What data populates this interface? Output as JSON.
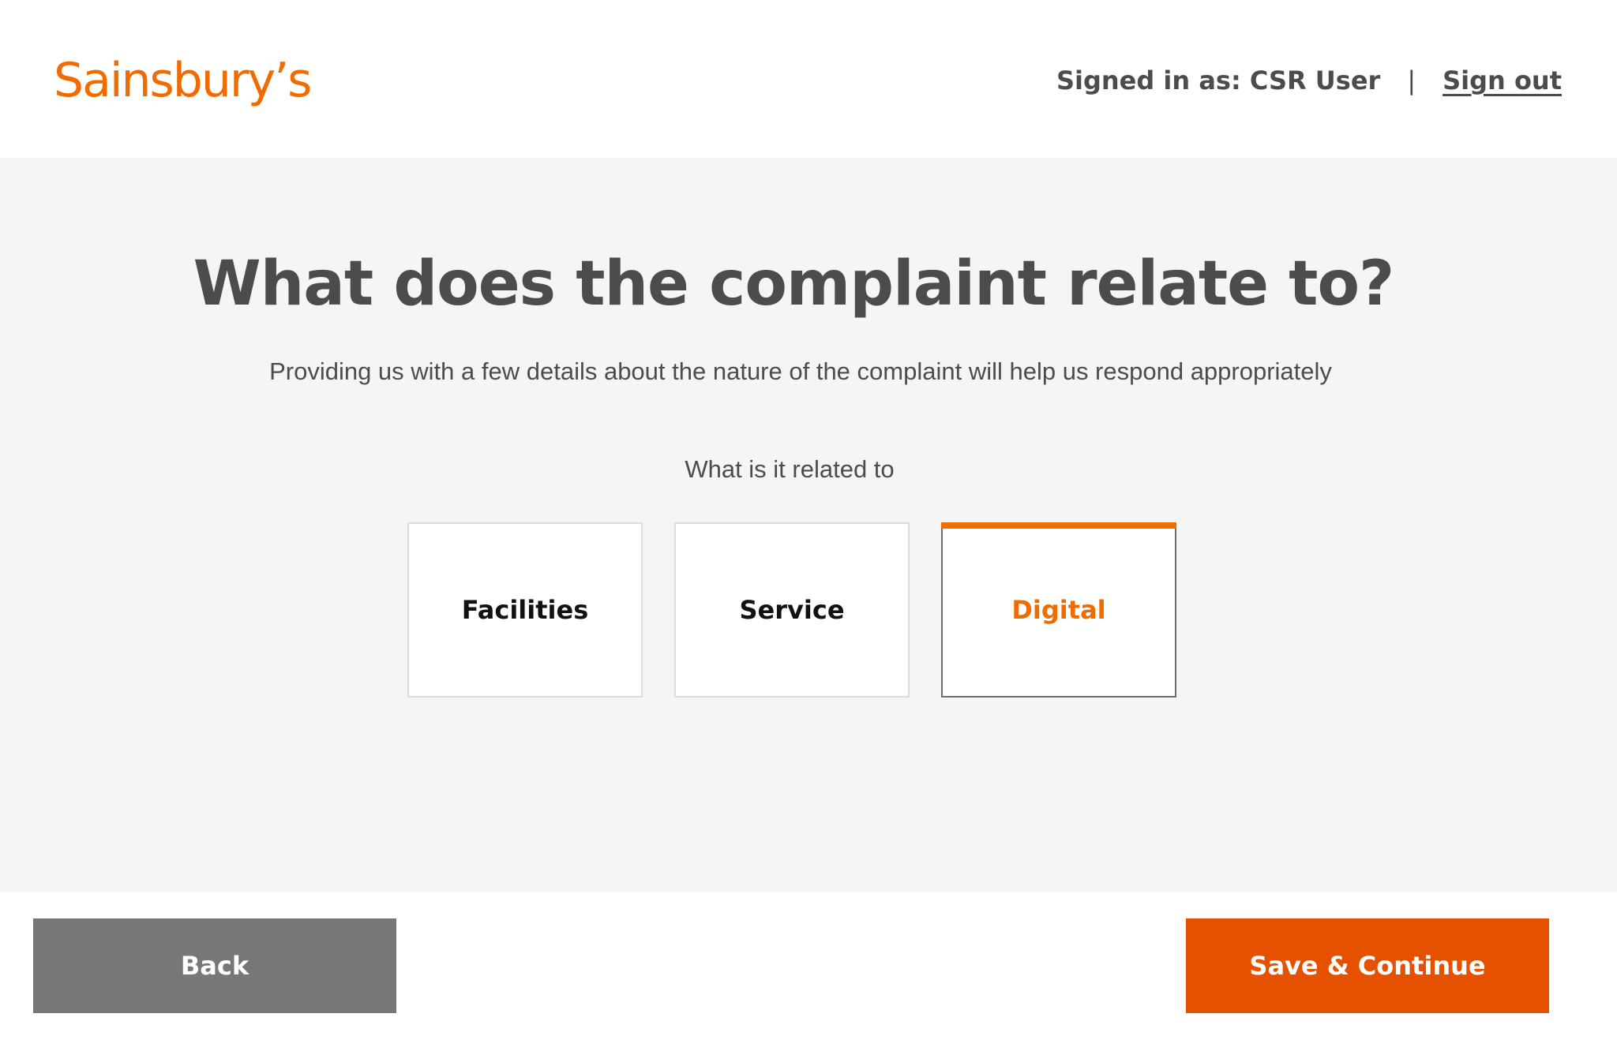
{
  "header": {
    "logo_text": "Sainsbury’s",
    "signed_in_label": "Signed in as: CSR User",
    "separator": "|",
    "sign_out_label": "Sign out"
  },
  "main": {
    "title": "What does the complaint relate to?",
    "subtitle": "Providing us with a few details about the nature of the complaint will help us respond appropriately",
    "question": "What is it related to",
    "options": [
      {
        "label": "Facilities",
        "selected": false
      },
      {
        "label": "Service",
        "selected": false
      },
      {
        "label": "Digital",
        "selected": true
      }
    ]
  },
  "footer": {
    "back_label": "Back",
    "continue_label": "Save & Continue"
  },
  "colors": {
    "brand_orange": "#f06c00",
    "continue_button": "#e65100",
    "back_button": "#777777",
    "main_background": "#f5f5f5",
    "text": "#4c4c4c"
  }
}
